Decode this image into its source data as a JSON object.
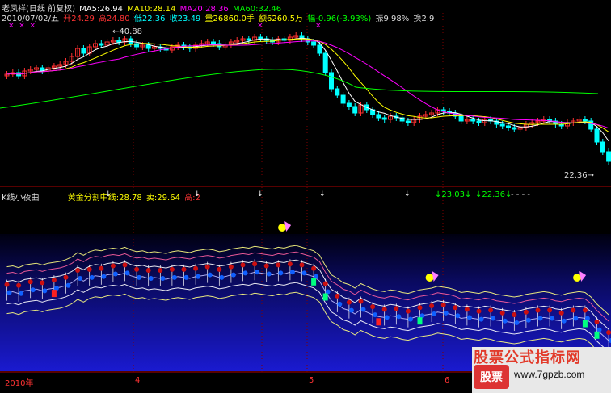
{
  "header": {
    "stock_name": "老凤祥(日线 前复权)",
    "ma5": "MA5:26.94",
    "ma10": "MA10:28.14",
    "ma20": "MA20:28.36",
    "ma60": "MA60:32.46",
    "date": "2010/07/02/五",
    "open": "开24.29",
    "high": "高24.80",
    "low": "低22.36",
    "close": "收23.49",
    "volume": "量26860.0手",
    "amount": "额6260.5万",
    "change": "幅-0.96(-3.93%)",
    "amplitude": "振9.98%",
    "turnover": "换2.9"
  },
  "price_labels": {
    "high_mark": "40.88",
    "low_mark": "22.36"
  },
  "indicator_header": {
    "title": "K线小夜曲",
    "golden_mid": "黄金分割中线:28.78",
    "sell": "卖:29.64",
    "high": "高:2",
    "val1": "23.03",
    "val2": "22.36"
  },
  "date_axis": {
    "year": "2010年",
    "m1": "4",
    "m2": "5",
    "m3": "6"
  },
  "watermark": {
    "title": "股票公式指标网",
    "url": "www.7gpzb.com",
    "logo": "股票"
  },
  "colors": {
    "up": "#ff3030",
    "down": "#00ffff",
    "ma5": "#ffffff",
    "ma10": "#ffff00",
    "ma20": "#ff00ff",
    "ma60": "#00ff00",
    "background": "#000000"
  }
}
